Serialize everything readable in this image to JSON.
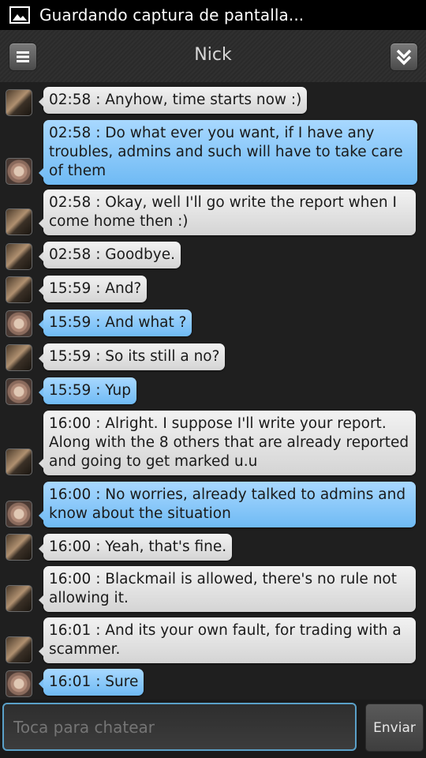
{
  "status_bar": {
    "text": "Guardando captura de pantalla...",
    "icon": "image-icon"
  },
  "header": {
    "title": "Nick",
    "menu_icon": "menu-icon",
    "collapse_icon": "double-chevron-down-icon"
  },
  "messages": [
    {
      "sender": "contact",
      "text": "02:58 : Anyhow, time starts now :)"
    },
    {
      "sender": "me",
      "text": "02:58 : Do what ever you want, if I have any troubles, admins and such will have to take care of them"
    },
    {
      "sender": "contact",
      "text": "02:58 : Okay, well I'll go write the report when I come home then :)"
    },
    {
      "sender": "contact",
      "text": "02:58 : Goodbye."
    },
    {
      "sender": "contact",
      "text": "15:59 : And?"
    },
    {
      "sender": "me",
      "text": "15:59 : And what ?"
    },
    {
      "sender": "contact",
      "text": "15:59 : So its still a no?"
    },
    {
      "sender": "me",
      "text": "15:59 : Yup"
    },
    {
      "sender": "contact",
      "text": "16:00 : Alright. I suppose I'll write your report. Along with the 8 others that are already reported and going to get marked u.u"
    },
    {
      "sender": "me",
      "text": "16:00 : No worries, already talked to admins and know about the situation"
    },
    {
      "sender": "contact",
      "text": "16:00 : Yeah, that's fine."
    },
    {
      "sender": "contact",
      "text": "16:00 : Blackmail is allowed, there's no rule not allowing it."
    },
    {
      "sender": "contact",
      "text": "16:01 : And its your own fault, for trading with a scammer."
    },
    {
      "sender": "me",
      "text": "16:01 : Sure"
    }
  ],
  "composer": {
    "placeholder": "Toca para chatear",
    "send_label": "Enviar"
  },
  "colors": {
    "contact_bubble": "#e0e0e0",
    "my_bubble": "#8ccaf8",
    "input_border": "#5aa0c8"
  }
}
